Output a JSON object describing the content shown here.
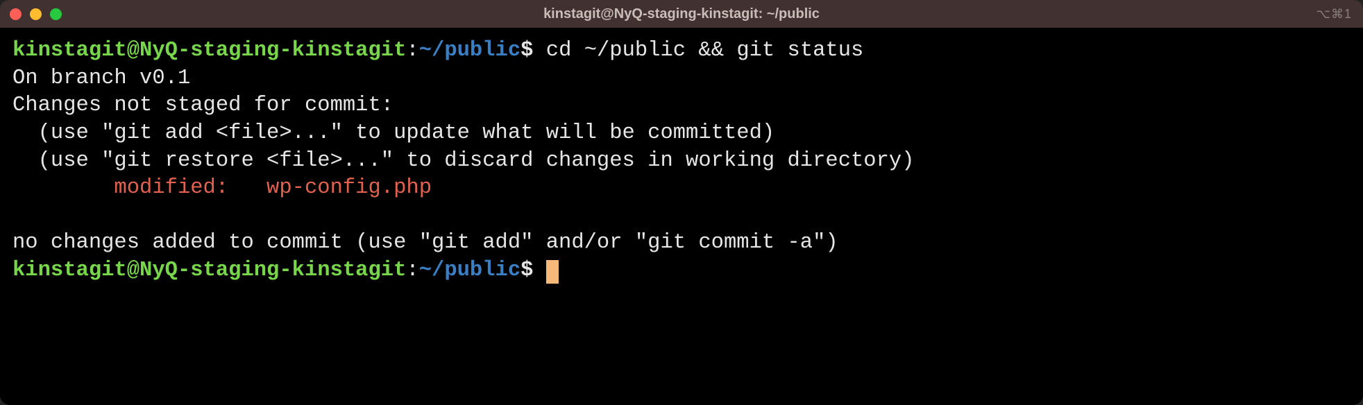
{
  "window": {
    "title": "kinstagit@NyQ-staging-kinstagit: ~/public",
    "shortcut_hint": "⌥⌘1"
  },
  "prompt": {
    "user_host": "kinstagit@NyQ-staging-kinstagit",
    "colon": ":",
    "path": "~/public",
    "symbol": "$"
  },
  "command": "cd ~/public && git status",
  "output": {
    "line1": "On branch v0.1",
    "line2": "Changes not staged for commit:",
    "line3": "  (use \"git add <file>...\" to update what will be committed)",
    "line4": "  (use \"git restore <file>...\" to discard changes in working directory)",
    "line5_modified": "        modified:   wp-config.php",
    "line_blank": "",
    "line6": "no changes added to commit (use \"git add\" and/or \"git commit -a\")"
  }
}
